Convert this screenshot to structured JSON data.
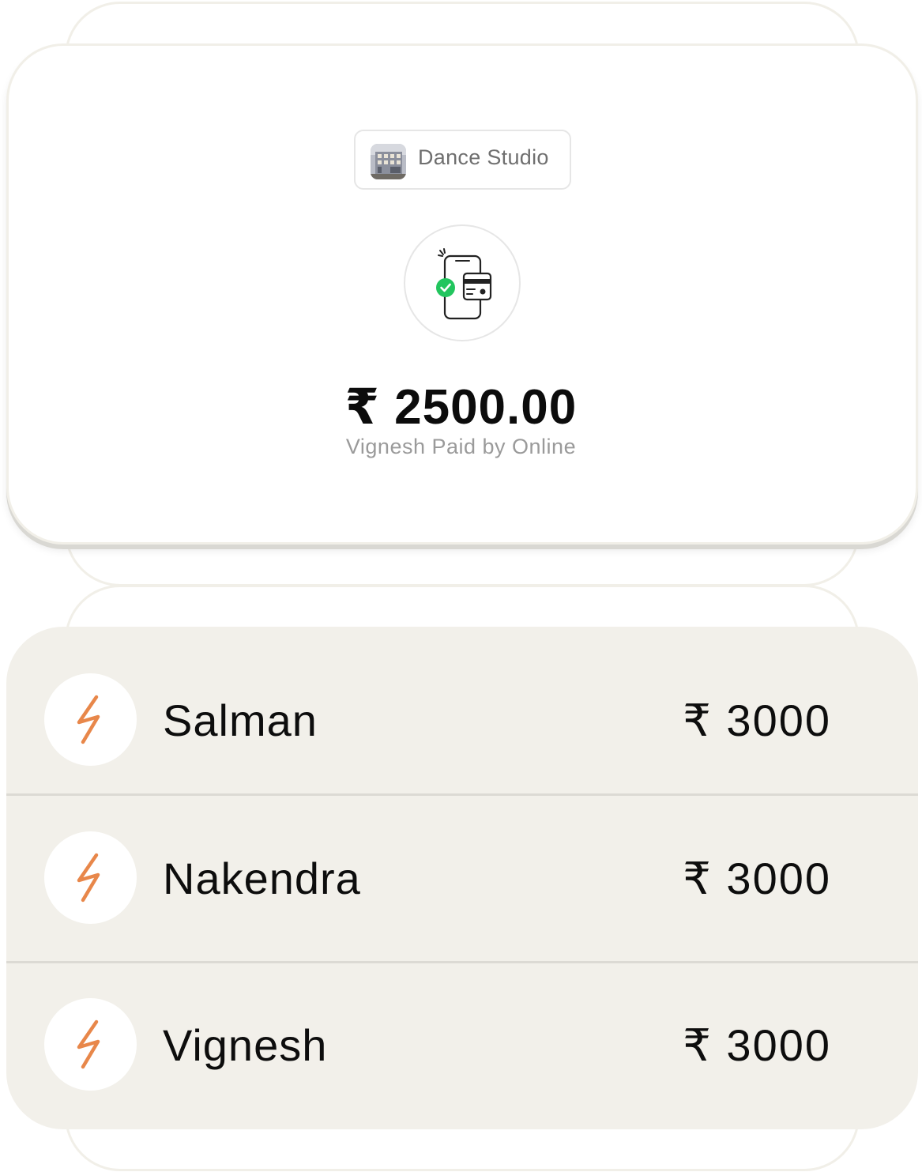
{
  "studio": {
    "name": "Dance Studio",
    "thumb_icon": "building-photo"
  },
  "payment": {
    "icon": "mobile-payment-success-icon",
    "amount": "₹ 2500.00",
    "subtitle": "Vignesh Paid by Online"
  },
  "payments_list": [
    {
      "name": "Salman",
      "amount": "₹ 3000",
      "icon": "lightning-icon"
    },
    {
      "name": "Nakendra",
      "amount": "₹ 3000",
      "icon": "lightning-icon"
    },
    {
      "name": "Vignesh",
      "amount": "₹ 3000",
      "icon": "lightning-icon"
    }
  ],
  "colors": {
    "accent": "#e8874a",
    "success": "#22c55e",
    "list_background": "#f2f0ea"
  }
}
